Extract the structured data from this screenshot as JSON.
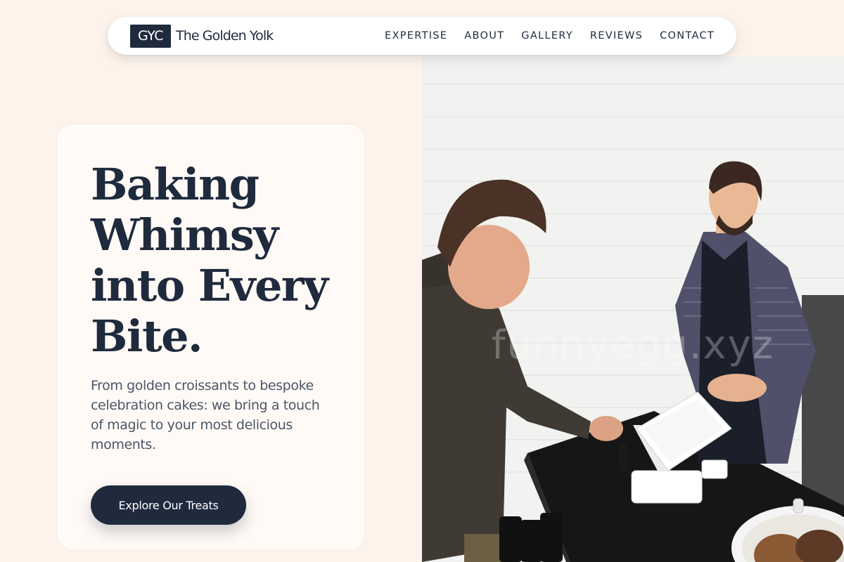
{
  "brand": {
    "mark": "GYC",
    "name": "The Golden Yolk"
  },
  "nav": {
    "links": [
      "EXPERTISE",
      "ABOUT",
      "GALLERY",
      "REVIEWS",
      "CONTACT"
    ]
  },
  "hero": {
    "title_lines": [
      "Baking",
      "Whimsy",
      "into Every",
      "Bite."
    ],
    "subtitle": "From golden croissants to bespoke celebration cakes: we bring a touch of magic to your most delicious moments.",
    "cta_label": "Explore Our Treats"
  },
  "photo": {
    "watermark": "funnyegg.xyz"
  },
  "colors": {
    "page_bg": "#fdf3eb",
    "navy": "#1f2a3d",
    "card_bg": "#fffaf6",
    "body_text": "#4c5566"
  }
}
